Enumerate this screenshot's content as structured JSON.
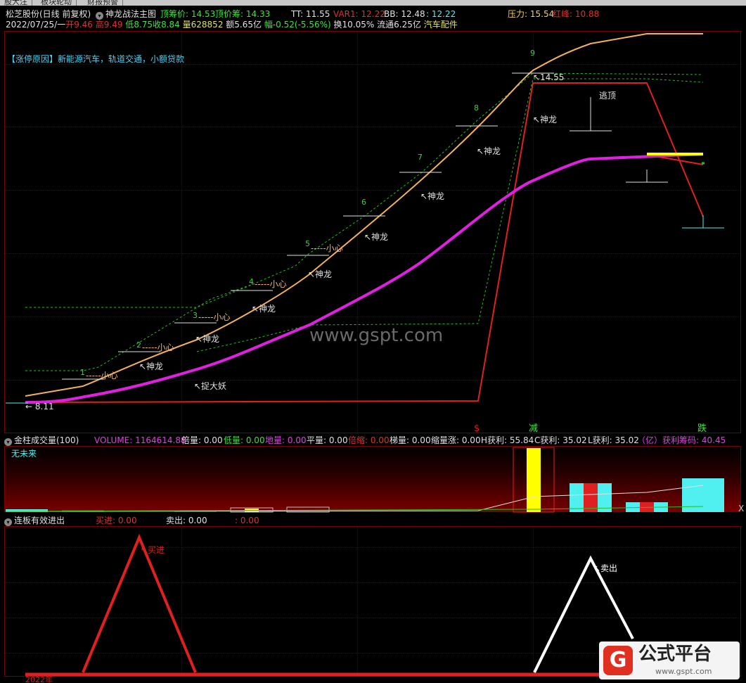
{
  "tabs": [
    "股大注",
    "板块轮动",
    "财报预警"
  ],
  "colors": {
    "red": "#e02020",
    "green": "#20d020",
    "cyan": "#50f0f0",
    "magenta": "#e020e0",
    "orange": "#f0b060",
    "yellow": "#ffff00",
    "white": "#ffffff"
  },
  "main_header": {
    "stock_name": "松芝股份(日线 前复权)",
    "indicator": "神龙战法主图",
    "top_price_label": "顶筹价: 14.53",
    "top_chip_label": "顶价筹: 14.33",
    "tt": "TT: 11.55",
    "var1": "VAR1: 12.22",
    "bb": "BB: 12.48",
    "bb2": ": 12.48",
    "bb3": ": 12.22",
    "pressure": "压力: 15.54",
    "red_peak": "红峰: 10.88"
  },
  "quote": {
    "date": "2022/07/25/一",
    "open": "开9.46",
    "high": "高9.49",
    "low": "低8.75",
    "close": "收8.84",
    "volume": "量628852",
    "amount": "额5.65亿",
    "amplitude": "幅-0.52(-5.56%)",
    "turnover": "换10.05%",
    "float_cap": "流通6.25亿",
    "industry": "汽车配件"
  },
  "limit_reason": "【涨停原因】新能源汽车，轨道交通，小额贷款",
  "chart_labels": {
    "dragon": "↖神龙",
    "careful": "-----小心",
    "catch": "↖捉大妖",
    "escape": "逃顶",
    "peak_price": "↖14.55",
    "low_price": "← 8.11",
    "watermark": "www.gspt.com",
    "counts": [
      "1",
      "2",
      "3",
      "4",
      "5",
      "6",
      "7",
      "8",
      "9"
    ],
    "markers": [
      "$",
      "减",
      "跌"
    ]
  },
  "volume_header": {
    "title": "金柱成交量(100)",
    "volume": "VOLUME: 1164614.88",
    "double": "倍量: 0.00",
    "low": "低量: 0.00",
    "ground": "地量: 0.00",
    "flat": "平量: 0.00",
    "shrink_double": "倍缩: 0.00",
    "ladder": "梯量: 0.00",
    "shrink_rise": "缩量涨: 0.00",
    "h_profit": "H获利: 55.84",
    "c_profit": "C获利: 35.02",
    "l_profit": "L获利: 35.02",
    "unit": "（亿）获利筹码: 40.45",
    "no_future": "无未来",
    "close_x": "X"
  },
  "signal_header": {
    "title": "连板有效进出",
    "buy": "买进: 0.00",
    "sell": "卖出: 0.00",
    "extra": ": 0.00",
    "buy_label": "↖买进",
    "sell_label": "↖卖出",
    "year": "2022年"
  },
  "logo": {
    "text": "公式平台",
    "url": "www.gspt.com"
  }
}
